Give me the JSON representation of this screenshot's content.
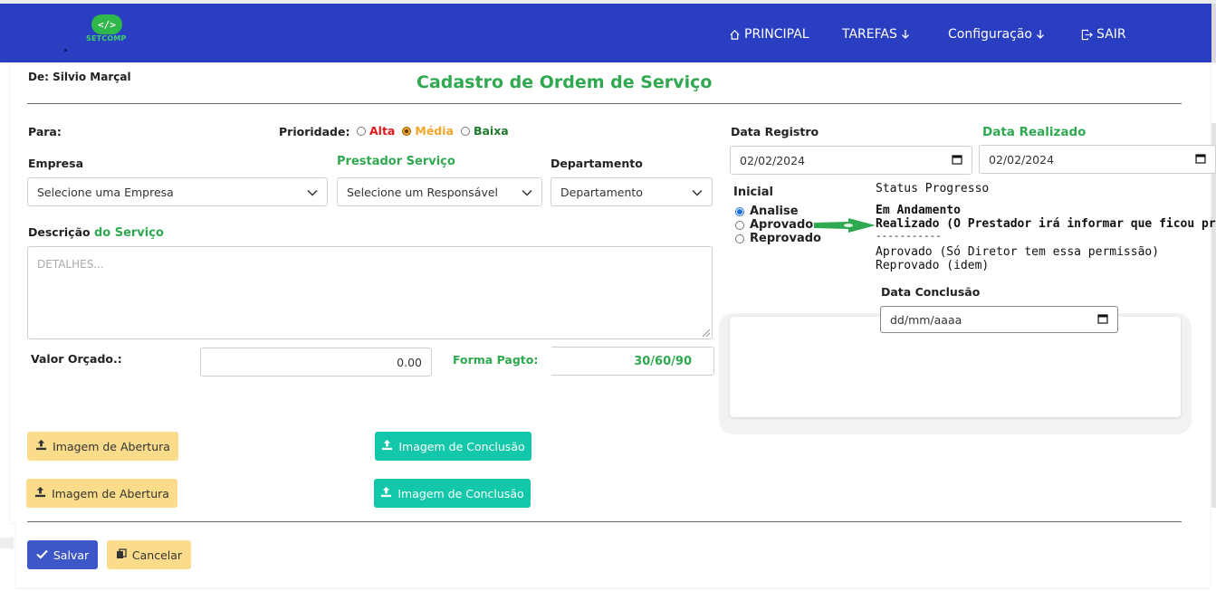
{
  "nav": {
    "logo_text": "SETCOMP",
    "logo_symbol": "</>",
    "items": [
      {
        "label": "PRINCIPAL",
        "icon": "home-icon"
      },
      {
        "label": "TAREFAS",
        "icon": "arrow-down-icon"
      },
      {
        "label": "Configuração",
        "icon": "arrow-down-icon"
      },
      {
        "label": "SAIR",
        "icon": "sign-out-icon"
      }
    ]
  },
  "form": {
    "from_label": "De: Silvio Marçal",
    "title": "Cadastro de Ordem de Serviço",
    "to_label": "Para:",
    "priority_label": "Prioridade:",
    "priority_options": [
      {
        "label": "Alta",
        "color": "#e01919",
        "selected": false
      },
      {
        "label": "Média",
        "color": "#f0a52a",
        "selected": true
      },
      {
        "label": "Baixa",
        "color": "#1f7a2e",
        "selected": false
      }
    ],
    "empresa_label": "Empresa",
    "empresa_value": "Selecione uma Empresa",
    "prestador_label": "Prestador Serviço",
    "prestador_value": "Selecione um Responsável",
    "departamento_label": "Departamento",
    "departamento_value": "Departamento",
    "descricao_label_1": "Descrição",
    "descricao_label_2": "do Serviço",
    "descricao_placeholder": "DETALHES...",
    "valor_label": "Valor Orçado.:",
    "valor_value": "0.00",
    "forma_label": "Forma Pagto:",
    "forma_value": "30/60/90",
    "data_registro_label": "Data Registro",
    "data_registro_value": "02/02/2024",
    "data_realizado_label": "Data Realizado",
    "data_realizado_value": "02/02/2024",
    "inicial_label": "Inicial",
    "inicial_options": [
      {
        "label": "Analise",
        "selected": true
      },
      {
        "label": "Aprovado",
        "selected": false
      },
      {
        "label": "Reprovado",
        "selected": false
      }
    ],
    "status_title": "Status Progresso",
    "status_lines": [
      "Em Andamento",
      "Realizado (O Prestador irá informar que ficou pronto)",
      "-----------",
      "Aprovado (Só Diretor tem essa permissão)",
      "Reprovado (idem)"
    ],
    "data_conclusao_label": "Data Conclusão",
    "data_conclusao_placeholder": "dd/mm/aaaa",
    "btn_imagem_abertura": "Imagem de Abertura",
    "btn_imagem_conclusao": "Imagem de Conclusão",
    "btn_salvar": "Salvar",
    "btn_cancelar": "Cancelar"
  },
  "colors": {
    "navbar": "#2a3ec2",
    "green_accent": "#2fa84f",
    "teal": "#13c7aa",
    "yellow": "#fbdc8b",
    "save_blue": "#3d56c8"
  }
}
